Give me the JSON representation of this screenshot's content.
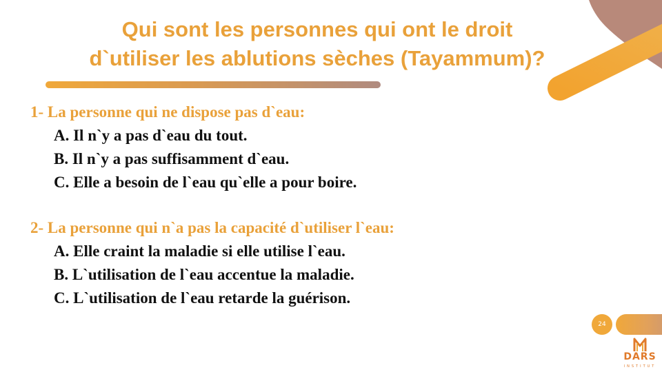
{
  "slide": {
    "title_lines": [
      "Qui sont les personnes qui ont le droit",
      "d`utiliser les ablutions sèches (Tayammum)?"
    ],
    "sections": [
      {
        "heading": "1- La personne qui ne dispose pas d`eau:",
        "items": [
          "A. Il n`y a pas d`eau du tout.",
          "B. Il n`y a pas suffisamment d`eau.",
          "C. Elle a besoin de l`eau qu`elle a pour boire."
        ]
      },
      {
        "heading": "2- La personne qui n`a pas la capacité d`utiliser l`eau:",
        "items": [
          "A. Elle craint la maladie si elle utilise l`eau.",
          "B. L`utilisation de l`eau accentue la maladie.",
          "C. L`utilisation de l`eau retarde la guérison."
        ]
      }
    ],
    "page_number": "24",
    "logo": {
      "name": "DARS",
      "subtitle": "INSTITUT"
    },
    "colors": {
      "accent": "#e9a13a",
      "orange": "#f0a83a",
      "mauve": "#b08b80",
      "text": "#111111"
    }
  }
}
